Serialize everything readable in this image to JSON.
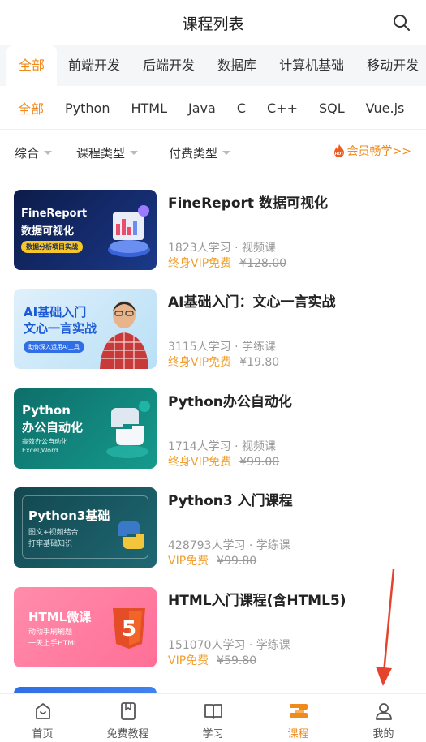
{
  "header": {
    "title": "课程列表",
    "search_icon": "search-icon"
  },
  "categories": [
    {
      "label": "全部",
      "active": true
    },
    {
      "label": "前端开发"
    },
    {
      "label": "后端开发"
    },
    {
      "label": "数据库"
    },
    {
      "label": "计算机基础"
    },
    {
      "label": "移动开发"
    }
  ],
  "sub_categories": [
    {
      "label": "全部",
      "active": true
    },
    {
      "label": "Python"
    },
    {
      "label": "HTML"
    },
    {
      "label": "Java"
    },
    {
      "label": "C"
    },
    {
      "label": "C++"
    },
    {
      "label": "SQL"
    },
    {
      "label": "Vue.js"
    }
  ],
  "filters": {
    "sort": "综合",
    "type": "课程类型",
    "pay": "付费类型",
    "vip_link": "会员畅学>>",
    "hot_badge": "HOT"
  },
  "courses": [
    {
      "name": "FineReport 数据可视化",
      "meta": "1823人学习 · 视频课",
      "vip": "终身VIP免费",
      "old_price": "¥128.00",
      "thumb": {
        "line1": "FineReport",
        "line2": "数据可视化",
        "tag": "数据分析项目实战"
      }
    },
    {
      "name": "AI基础入门：文心一言实战",
      "meta": "3115人学习 · 学练课",
      "vip": "终身VIP免费",
      "old_price": "¥19.80",
      "thumb": {
        "line1": "AI基础入门",
        "line2": "文心一言实战",
        "tag": "助你深入运用AI工具"
      }
    },
    {
      "name": "Python办公自动化",
      "meta": "1714人学习 · 视频课",
      "vip": "终身VIP免费",
      "old_price": "¥99.00",
      "thumb": {
        "line1": "Python",
        "line2": "办公自动化",
        "tag": "高效办公自动化",
        "tag2": "Excel,Word"
      }
    },
    {
      "name": "Python3 入门课程",
      "meta": "428793人学习 · 学练课",
      "vip": "VIP免费",
      "old_price": "¥99.80",
      "thumb": {
        "line1": "Python3基础",
        "line2": "图文+视频结合",
        "tag": "打牢基础知识"
      }
    },
    {
      "name": "HTML入门课程(含HTML5)",
      "meta": "151070人学习 · 学练课",
      "vip": "VIP免费",
      "old_price": "¥59.80",
      "thumb": {
        "line1": "HTML微课",
        "line2": "动动手刷刷题",
        "tag": "一天上手HTML",
        "badge": "5"
      }
    }
  ],
  "bottom_nav": [
    {
      "label": "首页",
      "icon": "home-icon"
    },
    {
      "label": "免费教程",
      "icon": "bookmark-icon"
    },
    {
      "label": "学习",
      "icon": "book-icon"
    },
    {
      "label": "课程",
      "icon": "course-icon",
      "active": true
    },
    {
      "label": "我的",
      "icon": "user-icon"
    }
  ],
  "colors": {
    "accent": "#f08a1c",
    "vip": "#f0a030",
    "arrow": "#e5432d"
  }
}
